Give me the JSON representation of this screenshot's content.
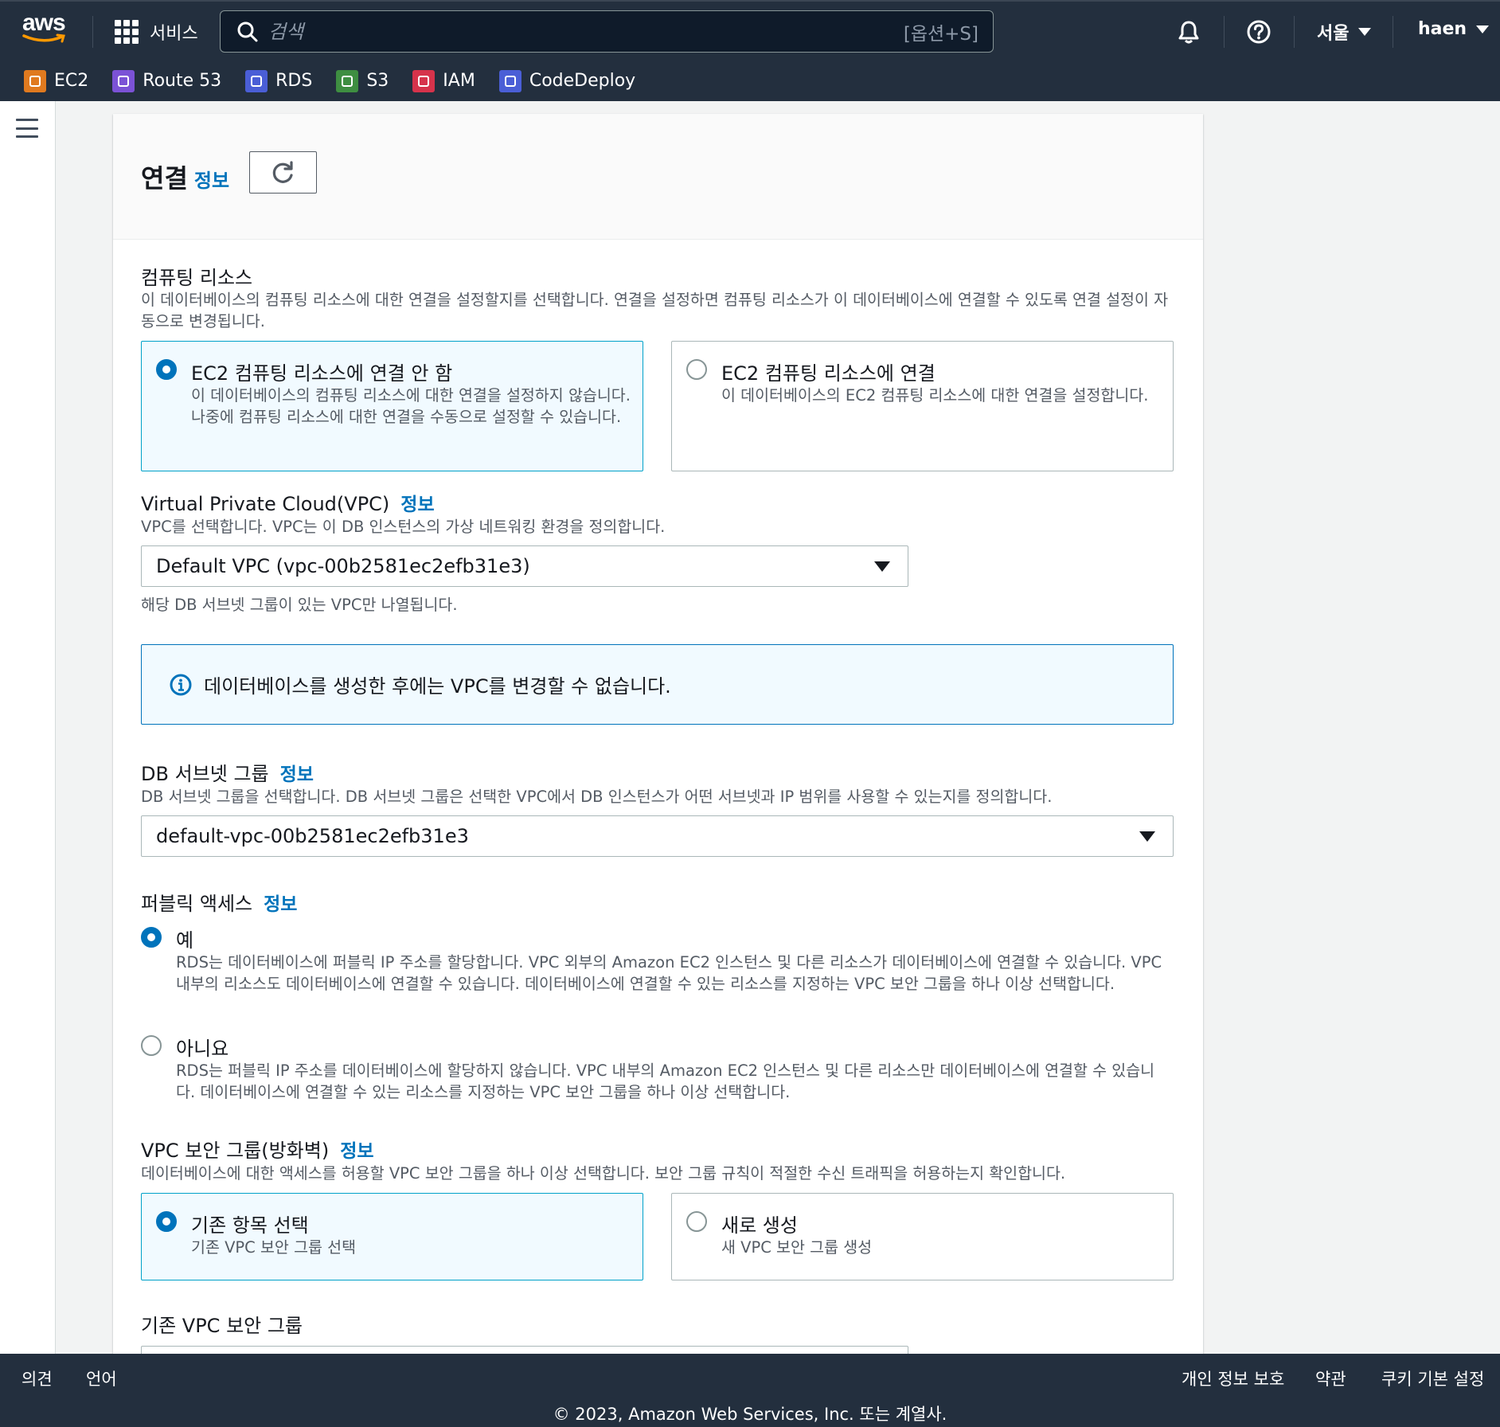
{
  "topnav": {
    "logo_text": "aws",
    "services_label": "서비스",
    "search_placeholder": "검색",
    "search_shortcut": "[옵션+S]",
    "region": "서울",
    "user": "haen"
  },
  "favorites": [
    {
      "label": "EC2",
      "icon": "ec2-icon",
      "color": "#e07a1f"
    },
    {
      "label": "Route 53",
      "icon": "route53-icon",
      "color": "#7b52d6"
    },
    {
      "label": "RDS",
      "icon": "rds-icon",
      "color": "#4a5ed6"
    },
    {
      "label": "S3",
      "icon": "s3-icon",
      "color": "#3e8e41"
    },
    {
      "label": "IAM",
      "icon": "iam-icon",
      "color": "#d6334b"
    },
    {
      "label": "CodeDeploy",
      "icon": "codedeploy-icon",
      "color": "#4a5ed6"
    }
  ],
  "header": {
    "title": "연결",
    "info": "정보"
  },
  "compute": {
    "label": "컴퓨팅 리소스",
    "desc": "이 데이터베이스의 컴퓨팅 리소스에 대한 연결을 설정할지를 선택합니다. 연결을 설정하면 컴퓨팅 리소스가 이 데이터베이스에 연결할 수 있도록 연결 설정이 자동으로 변경됩니다.",
    "options": [
      {
        "title": "EC2 컴퓨팅 리소스에 연결 안 함",
        "desc": "이 데이터베이스의 컴퓨팅 리소스에 대한 연결을 설정하지 않습니다. 나중에 컴퓨팅 리소스에 대한 연결을 수동으로 설정할 수 있습니다.",
        "selected": true
      },
      {
        "title": "EC2 컴퓨팅 리소스에 연결",
        "desc": "이 데이터베이스의 EC2 컴퓨팅 리소스에 대한 연결을 설정합니다.",
        "selected": false
      }
    ]
  },
  "vpc": {
    "label": "Virtual Private Cloud(VPC)",
    "info": "정보",
    "desc": "VPC를 선택합니다. VPC는 이 DB 인스턴스의 가상 네트워킹 환경을 정의합니다.",
    "value": "Default VPC (vpc-00b2581ec2efb31e3)",
    "hint": "해당 DB 서브넷 그룹이 있는 VPC만 나열됩니다.",
    "alert": "데이터베이스를 생성한 후에는 VPC를 변경할 수 없습니다."
  },
  "subnet": {
    "label": "DB 서브넷 그룹",
    "info": "정보",
    "desc": "DB 서브넷 그룹을 선택합니다. DB 서브넷 그룹은 선택한 VPC에서 DB 인스턴스가 어떤 서브넷과 IP 범위를 사용할 수 있는지를 정의합니다.",
    "value": "default-vpc-00b2581ec2efb31e3"
  },
  "public_access": {
    "label": "퍼블릭 액세스",
    "info": "정보",
    "yes_title": "예",
    "yes_desc": "RDS는 데이터베이스에 퍼블릭 IP 주소를 할당합니다. VPC 외부의 Amazon EC2 인스턴스 및 다른 리소스가 데이터베이스에 연결할 수 있습니다. VPC 내부의 리소스도 데이터베이스에 연결할 수 있습니다. 데이터베이스에 연결할 수 있는 리소스를 지정하는 VPC 보안 그룹을 하나 이상 선택합니다.",
    "no_title": "아니요",
    "no_desc": "RDS는 퍼블릭 IP 주소를 데이터베이스에 할당하지 않습니다. VPC 내부의 Amazon EC2 인스턴스 및 다른 리소스만 데이터베이스에 연결할 수 있습니다. 데이터베이스에 연결할 수 있는 리소스를 지정하는 VPC 보안 그룹을 하나 이상 선택합니다.",
    "selected": "yes"
  },
  "security_group": {
    "label": "VPC 보안 그룹(방화벽)",
    "info": "정보",
    "desc": "데이터베이스에 대한 액세스를 허용할 VPC 보안 그룹을 하나 이상 선택합니다. 보안 그룹 규칙이 적절한 수신 트래픽을 허용하는지 확인합니다.",
    "options": [
      {
        "title": "기존 항목 선택",
        "desc": "기존 VPC 보안 그룹 선택",
        "selected": true
      },
      {
        "title": "새로 생성",
        "desc": "새 VPC 보안 그룹 생성",
        "selected": false
      }
    ],
    "existing_label": "기존 VPC 보안 그룹"
  },
  "footer": {
    "feedback": "의견",
    "language": "언어",
    "privacy": "개인 정보 보호",
    "terms": "약관",
    "cookies": "쿠키 기본 설정",
    "copyright": "© 2023, Amazon Web Services, Inc. 또는 계열사."
  },
  "colors": {
    "nav_bg": "#232f3e",
    "accent": "#0073bb",
    "selected_tile_bg": "#f1faff",
    "selected_tile_border": "#00a1c9"
  }
}
